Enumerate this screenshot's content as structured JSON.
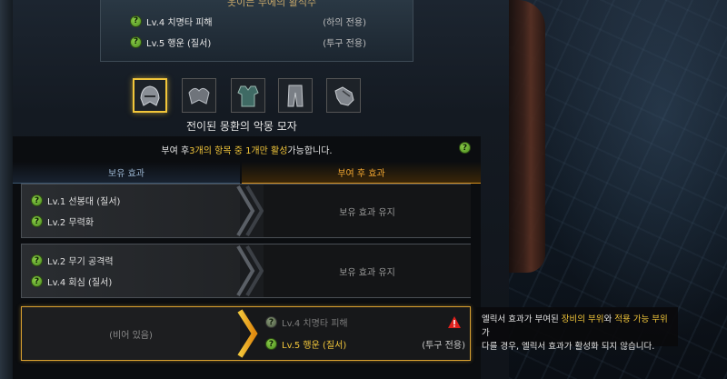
{
  "header": {
    "title": "옷이는 무에의 활석수",
    "effects": [
      {
        "label": "Lv.4 치명타 피해",
        "part": "(하의 전용)"
      },
      {
        "label": "Lv.5 행운 (질서)",
        "part": "(투구 전용)"
      }
    ]
  },
  "equipment": {
    "slots": [
      {
        "name": "helmet",
        "icon": "helmet-icon"
      },
      {
        "name": "shoulder",
        "icon": "shoulder-icon"
      },
      {
        "name": "chest",
        "icon": "chest-armor-icon"
      },
      {
        "name": "pants",
        "icon": "pants-icon"
      },
      {
        "name": "gloves",
        "icon": "gloves-icon"
      }
    ],
    "selected_index": 0,
    "selected_title": "전이된 몽환의 악몽 모자"
  },
  "notice": {
    "prefix": "부여 후 ",
    "hl1": "3개의 항목 중 1개만 활성",
    "suffix": " 가능합니다."
  },
  "columns": {
    "left": "보유 효과",
    "right": "부여 후 효과"
  },
  "rows": [
    {
      "effects": [
        "Lv.1 선봉대 (질서)",
        "Lv.2 무력화"
      ],
      "result": "보유 효과 유지"
    },
    {
      "effects": [
        "Lv.2 무기 공격력",
        "Lv.4 회심 (질서)"
      ],
      "result": "보유 효과 유지"
    }
  ],
  "row3": {
    "empty": "(비어 있음)",
    "effects": [
      {
        "label": "Lv.4 치명타 피해",
        "part": ""
      },
      {
        "label": "Lv.5 행운 (질서)",
        "part": "(투구 전용)"
      }
    ]
  },
  "tooltip": {
    "t1": "엘릭서 효과가 부여된 ",
    "hl1": "장비의 부위",
    "t2": "와 ",
    "hl2": "적용 가능 부위",
    "t3": "가",
    "line2": "다를 경우, 엘릭서 효과가 활성화 되지 않습니다."
  },
  "colors": {
    "accent": "#f2c63a",
    "active_column": "#f2a630",
    "inactive_column": "#9ab4cf",
    "warning": "#e0201c"
  }
}
